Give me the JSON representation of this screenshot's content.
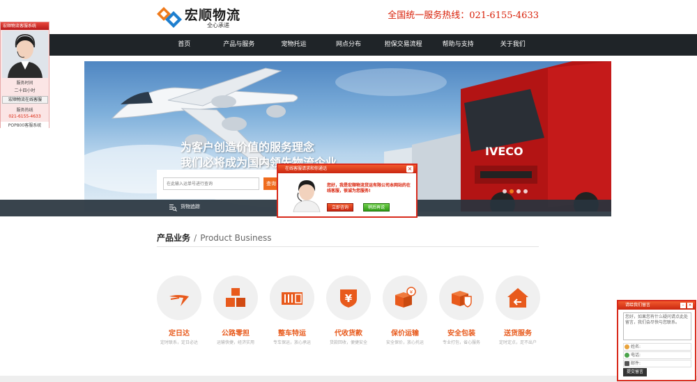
{
  "header": {
    "logo_name": "宏顺物流",
    "logo_slogan": "全心承递",
    "hotline": "全国统一服务热线：021-6155-4633"
  },
  "nav": {
    "items": [
      "首页",
      "产品与服务",
      "宠物托运",
      "网点分布",
      "担保交易流程",
      "帮助与支持",
      "关于我们"
    ]
  },
  "banner": {
    "line1": "为客户创造价值的服务理念",
    "line2": "我们必将成为国内领先物流企业"
  },
  "tracker": {
    "placeholder": "在此输入运单号进行查询",
    "button": "查询",
    "label": "货物追踪"
  },
  "section": {
    "title_cn": "产品业务",
    "separator": "/",
    "title_en": "Product Business"
  },
  "products": [
    {
      "name": "定日达",
      "desc": "定时联系，定日必达"
    },
    {
      "name": "公路零担",
      "desc": "运输快捷，经济实用"
    },
    {
      "name": "整车特运",
      "desc": "专车保运，放心承运"
    },
    {
      "name": "代收货款",
      "desc": "货款回收，便捷安全"
    },
    {
      "name": "保价运输",
      "desc": "安全保价，放心托运"
    },
    {
      "name": "安全包装",
      "desc": "专业打包，省心服务"
    },
    {
      "name": "送货服务",
      "desc": "定时定点，足不出户"
    }
  ],
  "left_service": {
    "title": "宏顺物流客服系统",
    "hours_label": "服务时间",
    "hours": "二十四小时",
    "online_button": "宏顺物流在线客服",
    "phone_label": "服务热线",
    "phone": "021-6155-4633",
    "footer": "POP800客服系统"
  },
  "popup": {
    "title": "在线客服请求和你通话",
    "message": "您好，我是宏顺物流货运有限公司本网站的在线客服，很诚为您服务!",
    "accept": "立即咨询",
    "later": "稍后再说"
  },
  "message_box": {
    "title": "请给我们留言",
    "placeholder": "您好，如果您有什么疑问请点此处留言，我们会尽快与您联系。",
    "name_label": "姓名:",
    "phone_label": "电话:",
    "email_label": "邮件:",
    "submit": "提交留言"
  },
  "colors": {
    "accent": "#e85a1c",
    "nav_bg": "#1f2428",
    "hotline": "#d81e06",
    "popup_red": "#d8291b"
  }
}
